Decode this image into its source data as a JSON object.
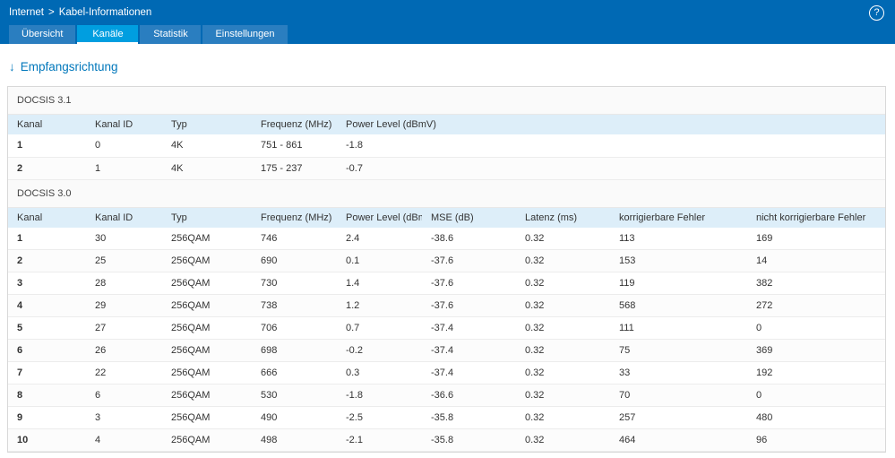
{
  "header": {
    "breadcrumb_parent": "Internet",
    "breadcrumb_separator": ">",
    "breadcrumb_current": "Kabel-Informationen",
    "help_label": "?"
  },
  "tabs": [
    {
      "label": "Übersicht",
      "active": false
    },
    {
      "label": "Kanäle",
      "active": true
    },
    {
      "label": "Statistik",
      "active": false
    },
    {
      "label": "Einstellungen",
      "active": false
    }
  ],
  "section": {
    "arrow": "↓",
    "title": "Empfangsrichtung"
  },
  "docsis31": {
    "title": "DOCSIS 3.1",
    "headers": [
      "Kanal",
      "Kanal ID",
      "Typ",
      "Frequenz (MHz)",
      "Power Level (dBmV)"
    ],
    "rows": [
      [
        "1",
        "0",
        "4K",
        "751 - 861",
        "-1.8"
      ],
      [
        "2",
        "1",
        "4K",
        "175 - 237",
        "-0.7"
      ]
    ]
  },
  "docsis30": {
    "title": "DOCSIS 3.0",
    "headers": [
      "Kanal",
      "Kanal ID",
      "Typ",
      "Frequenz (MHz)",
      "Power Level (dBmV)",
      "MSE (dB)",
      "Latenz (ms)",
      "korrigierbare Fehler",
      "nicht korrigierbare Fehler"
    ],
    "rows": [
      [
        "1",
        "30",
        "256QAM",
        "746",
        "2.4",
        "-38.6",
        "0.32",
        "113",
        "169"
      ],
      [
        "2",
        "25",
        "256QAM",
        "690",
        "0.1",
        "-37.6",
        "0.32",
        "153",
        "14"
      ],
      [
        "3",
        "28",
        "256QAM",
        "730",
        "1.4",
        "-37.6",
        "0.32",
        "119",
        "382"
      ],
      [
        "4",
        "29",
        "256QAM",
        "738",
        "1.2",
        "-37.6",
        "0.32",
        "568",
        "272"
      ],
      [
        "5",
        "27",
        "256QAM",
        "706",
        "0.7",
        "-37.4",
        "0.32",
        "111",
        "0"
      ],
      [
        "6",
        "26",
        "256QAM",
        "698",
        "-0.2",
        "-37.4",
        "0.32",
        "75",
        "369"
      ],
      [
        "7",
        "22",
        "256QAM",
        "666",
        "0.3",
        "-37.4",
        "0.32",
        "33",
        "192"
      ],
      [
        "8",
        "6",
        "256QAM",
        "530",
        "-1.8",
        "-36.6",
        "0.32",
        "70",
        "0"
      ],
      [
        "9",
        "3",
        "256QAM",
        "490",
        "-2.5",
        "-35.8",
        "0.32",
        "257",
        "480"
      ],
      [
        "10",
        "4",
        "256QAM",
        "498",
        "-2.1",
        "-35.8",
        "0.32",
        "464",
        "96"
      ]
    ]
  },
  "colors": {
    "header_blue": "#0069b4",
    "active_tab_blue": "#009ee0",
    "table_header_blue": "#ddeef9",
    "link_blue": "#0077bb"
  }
}
